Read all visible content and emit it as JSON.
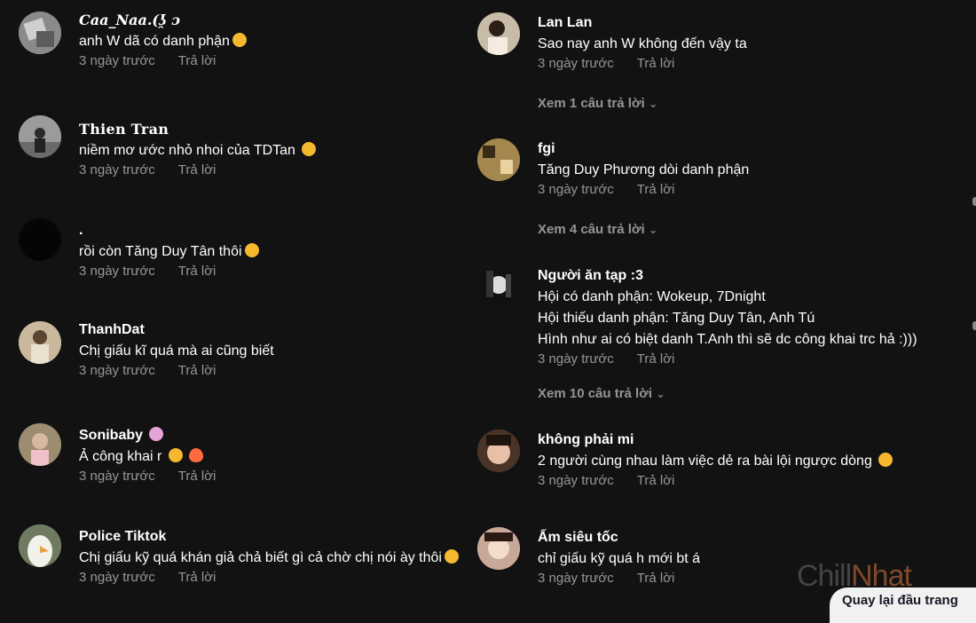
{
  "left_comments": [
    {
      "username": "Caa_Naa.(ʖ̯ ɔ",
      "text": "anh W dã có danh phận",
      "time": "3 ngày trước",
      "reply": "Trả lời",
      "avatar_color": "#9a9a9a"
    },
    {
      "username": "Thien Tran",
      "text": "niềm mơ ước nhỏ nhoi của TDTan",
      "time": "3 ngày trước",
      "reply": "Trả lời",
      "avatar_color": "#7d7d7d"
    },
    {
      "username": ".",
      "text": "rồi còn Tăng Duy Tân thôi",
      "time": "3 ngày trước",
      "reply": "Trả lời",
      "avatar_color": "#050505"
    },
    {
      "username": "ThanhDat",
      "text": "Chị giấu kĩ quá mà ai cũng biết",
      "time": "3 ngày trước",
      "reply": "Trả lời",
      "avatar_color": "#b9a58a"
    },
    {
      "username": "Sonibaby",
      "text": "Ả công khai r",
      "time": "3 ngày trước",
      "reply": "Trả lời",
      "avatar_color": "#8a7d6a"
    },
    {
      "username": "Police Tiktok",
      "text": "Chị giấu kỹ quá khán giả chả biết gì cả  chờ chị nói ày thôi",
      "time": "3 ngày trước",
      "reply": "Trả lời",
      "avatar_color": "#dcdcd0"
    }
  ],
  "right_comments": [
    {
      "username": "Lan Lan",
      "text": "Sao nay anh W không đến vậy ta",
      "time": "3 ngày trước",
      "reply": "Trả lời",
      "view_more": "Xem 1 câu trả lời",
      "avatar_color": "#b8a898"
    },
    {
      "username": "fgi",
      "text": "Tăng Duy Phương dòi danh phận",
      "time": "3 ngày trước",
      "reply": "Trả lời",
      "view_more": "Xem 4 câu trả lời",
      "avatar_color": "#8b6b3e"
    },
    {
      "username": "Người ăn tạp :3",
      "text_lines": [
        "Hội có danh phận: Wokeup, 7Dnight",
        "Hội thiếu danh phận: Tăng Duy Tân, Anh Tú",
        "Hình như ai có biệt danh T.Anh thì sẽ dc công khai trc hả :)))"
      ],
      "time": "3 ngày trước",
      "reply": "Trả lời",
      "view_more": "Xem 10 câu trả lời",
      "avatar_color": "#222222"
    },
    {
      "username": "không phải mi",
      "text": "2 người cùng nhau làm việc dẻ ra bài lội ngược dòng",
      "time": "3 ngày trước",
      "reply": "Trả lời",
      "avatar_color": "#6b4a3a"
    },
    {
      "username": "Ấm siêu tốc",
      "text": "chỉ giấu kỹ quá h mới bt á",
      "time": "3 ngày trước",
      "reply": "Trả lời",
      "avatar_color": "#d8b8a8"
    }
  ],
  "watermark": {
    "part1": "Chill",
    "part2": "Nhat"
  },
  "back_to_top": "Quay lại đầu trang"
}
